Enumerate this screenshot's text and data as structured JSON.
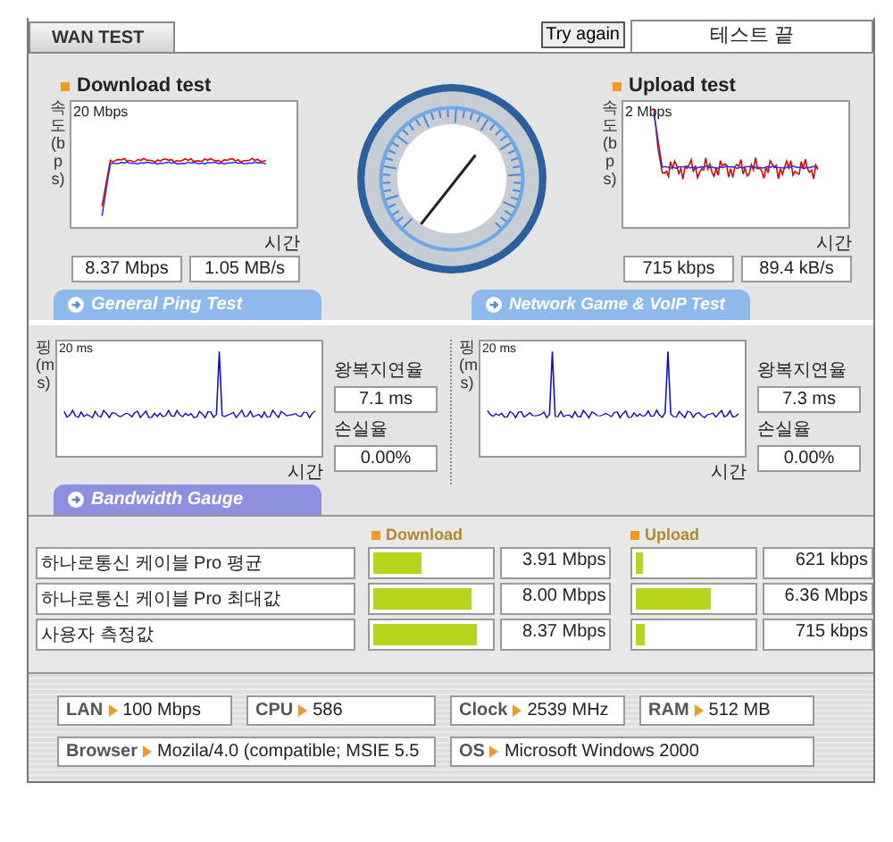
{
  "tab": {
    "label": "WAN TEST"
  },
  "try_again": "Try again",
  "status": "테스트 끝",
  "speed_tests": [
    {
      "title": "Download test",
      "y_axis": "속도(bps)",
      "scale": "20 Mbps",
      "x_axis": "시간",
      "readings": [
        "8.37 Mbps",
        "1.05 MB/s"
      ]
    },
    {
      "title": "Upload test",
      "y_axis": "속도(bps)",
      "scale": "2 Mbps",
      "x_axis": "시간",
      "readings": [
        "715 kbps",
        "89.4 kB/s"
      ]
    }
  ],
  "ping_tests": [
    {
      "heading": "General Ping Test",
      "y_axis": "핑(ms)",
      "scale": "20 ms",
      "x_axis": "시간",
      "latency_label": "왕복지연율",
      "latency": "7.1 ms",
      "loss_label": "손실율",
      "loss": "0.00%"
    },
    {
      "heading": "Network Game & VoIP Test",
      "y_axis": "핑(ms)",
      "scale": "20 ms",
      "x_axis": "시간",
      "latency_label": "왕복지연율",
      "latency": "7.3 ms",
      "loss_label": "손실율",
      "loss": "0.00%"
    }
  ],
  "bandwidth": {
    "heading": "Bandwidth Gauge",
    "columns": [
      "Download",
      "Upload"
    ],
    "rows": [
      {
        "name": "하나로통신 케이블 Pro 평균",
        "download": {
          "level": 0.41,
          "value": "3.91 Mbps"
        },
        "upload": {
          "level": 0.06,
          "value": "621 kbps"
        }
      },
      {
        "name": "하나로통신 케이블 Pro 최대값",
        "download": {
          "level": 0.85,
          "value": "8.00 Mbps"
        },
        "upload": {
          "level": 0.65,
          "value": "6.36 Mbps"
        }
      },
      {
        "name": "사용자 측정값",
        "download": {
          "level": 0.89,
          "value": "8.37 Mbps"
        },
        "upload": {
          "level": 0.07,
          "value": "715 kbps"
        }
      }
    ]
  },
  "system_info": [
    {
      "label": "LAN",
      "value": "100 Mbps"
    },
    {
      "label": "CPU",
      "value": "586"
    },
    {
      "label": "Clock",
      "value": "2539 MHz"
    },
    {
      "label": "RAM",
      "value": "512 MB"
    },
    {
      "label": "Browser",
      "value": "Mozila/4.0 (compatible; MSIE 5.5"
    },
    {
      "label": "OS",
      "value": "Microsoft Windows 2000"
    }
  ]
}
